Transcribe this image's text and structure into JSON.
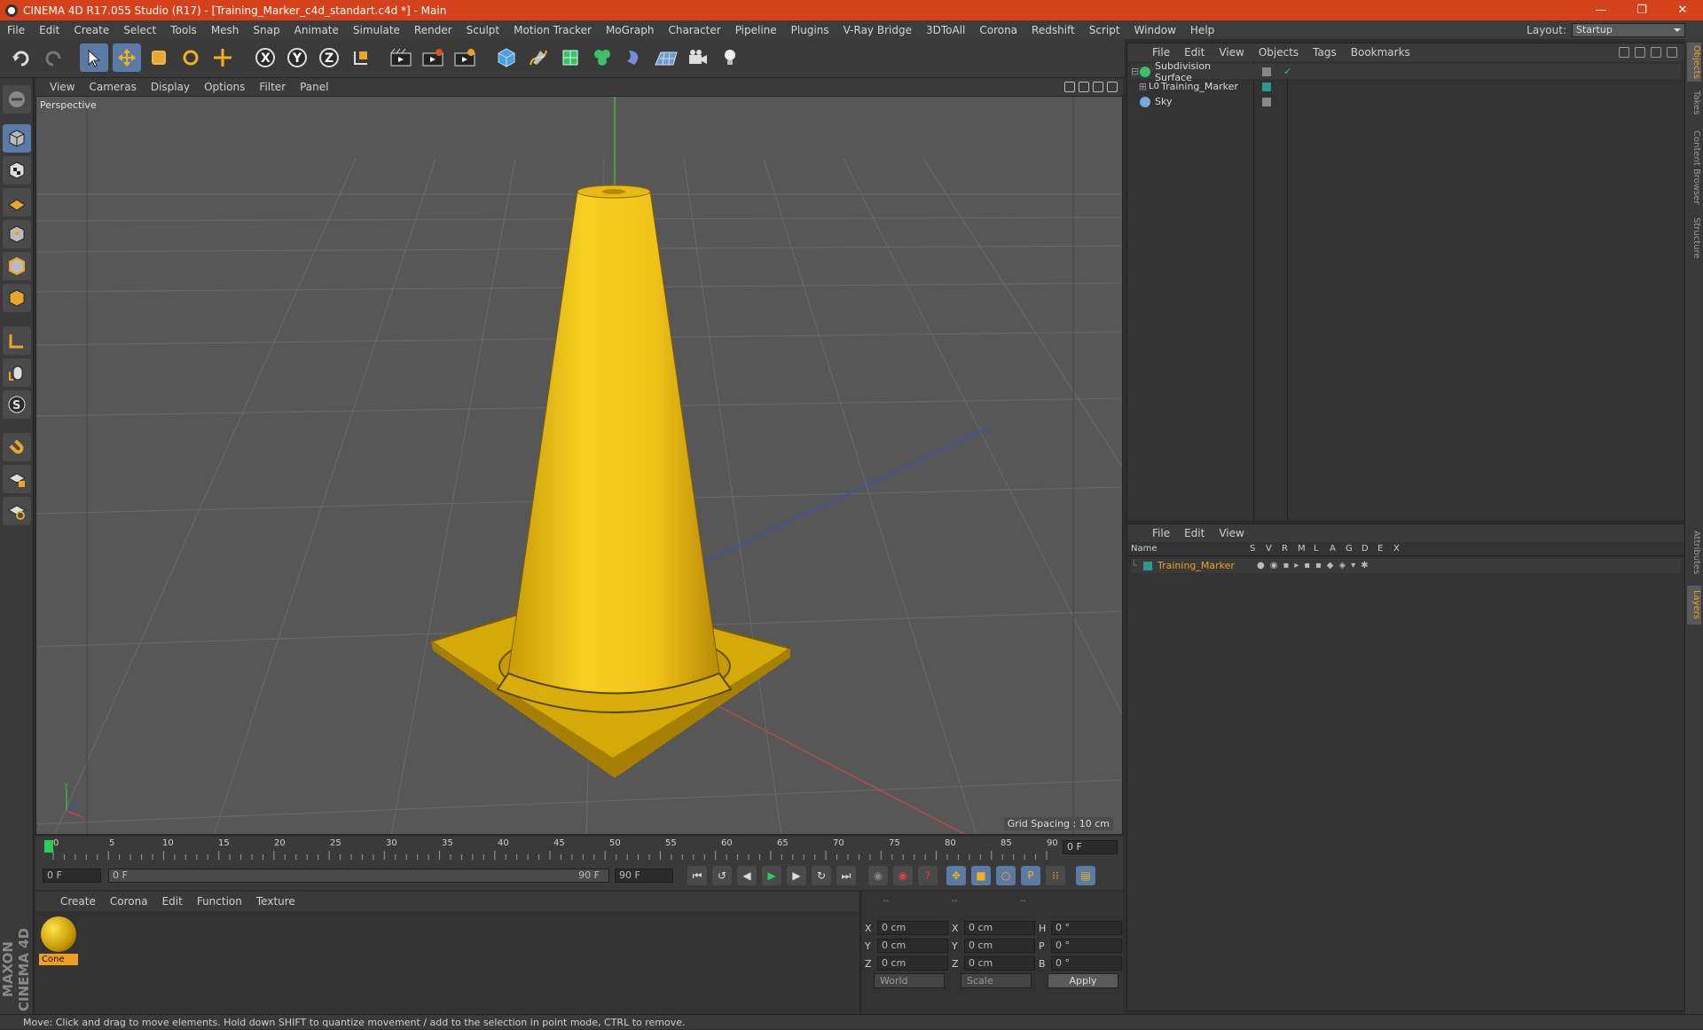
{
  "window": {
    "title": "CINEMA 4D R17.055 Studio (R17) - [Training_Marker_c4d_standart.c4d *] - Main"
  },
  "menubar": {
    "items": [
      "File",
      "Edit",
      "Create",
      "Select",
      "Tools",
      "Mesh",
      "Snap",
      "Animate",
      "Simulate",
      "Render",
      "Sculpt",
      "Motion Tracker",
      "MoGraph",
      "Character",
      "Pipeline",
      "Plugins",
      "V-Ray Bridge",
      "3DToAll",
      "Corona",
      "Redshift",
      "Script",
      "Window",
      "Help"
    ],
    "layout_label": "Layout:",
    "layout_value": "Startup"
  },
  "viewport": {
    "menu": [
      "View",
      "Cameras",
      "Display",
      "Options",
      "Filter",
      "Panel"
    ],
    "label": "Perspective",
    "grid_spacing": "Grid Spacing : 10 cm"
  },
  "timeline": {
    "ticks": [
      "0",
      "5",
      "10",
      "15",
      "20",
      "25",
      "30",
      "35",
      "40",
      "45",
      "50",
      "55",
      "60",
      "65",
      "70",
      "75",
      "80",
      "85",
      "90"
    ],
    "current_frame": "0 F",
    "start_field": "0 F",
    "range_start": "0 F",
    "range_end": "90 F",
    "end_field": "90 F"
  },
  "materials": {
    "menu": [
      "Create",
      "Corona",
      "Edit",
      "Function",
      "Texture"
    ],
    "items": [
      {
        "name": "Cone"
      }
    ]
  },
  "coords": {
    "headers": [
      "--",
      "--",
      "--"
    ],
    "rows": [
      {
        "a": "X",
        "v1": "0 cm",
        "b": "X",
        "v2": "0 cm",
        "c": "H",
        "v3": "0 °"
      },
      {
        "a": "Y",
        "v1": "0 cm",
        "b": "Y",
        "v2": "0 cm",
        "c": "P",
        "v3": "0 °"
      },
      {
        "a": "Z",
        "v1": "0 cm",
        "b": "Z",
        "v2": "0 cm",
        "c": "B",
        "v3": "0 °"
      }
    ],
    "mode": "World",
    "scale": "Scale",
    "apply": "Apply"
  },
  "objects": {
    "menu": [
      "File",
      "Edit",
      "View",
      "Objects",
      "Tags",
      "Bookmarks"
    ],
    "items": [
      {
        "name": "Subdivision Surface"
      },
      {
        "name": "Training_Marker"
      },
      {
        "name": "Sky"
      }
    ]
  },
  "layers": {
    "menu": [
      "File",
      "Edit",
      "View"
    ],
    "columns": [
      "Name",
      "S",
      "V",
      "R",
      "M",
      "L",
      "A",
      "G",
      "D",
      "E",
      "X"
    ],
    "items": [
      {
        "name": "Training_Marker"
      }
    ]
  },
  "sidetabs": [
    "Objects",
    "Takes",
    "Content Browser",
    "Structure",
    "Attributes",
    "Layers"
  ],
  "status": "Move: Click and drag to move elements. Hold down SHIFT to quantize movement / add to the selection in point mode, CTRL to remove.",
  "brand": {
    "logo_text": "MAXON CINEMA 4D"
  },
  "colors": {
    "title_bar": "#d5411a",
    "cone": "#f2c418",
    "selected_layer": "#f0a020"
  }
}
